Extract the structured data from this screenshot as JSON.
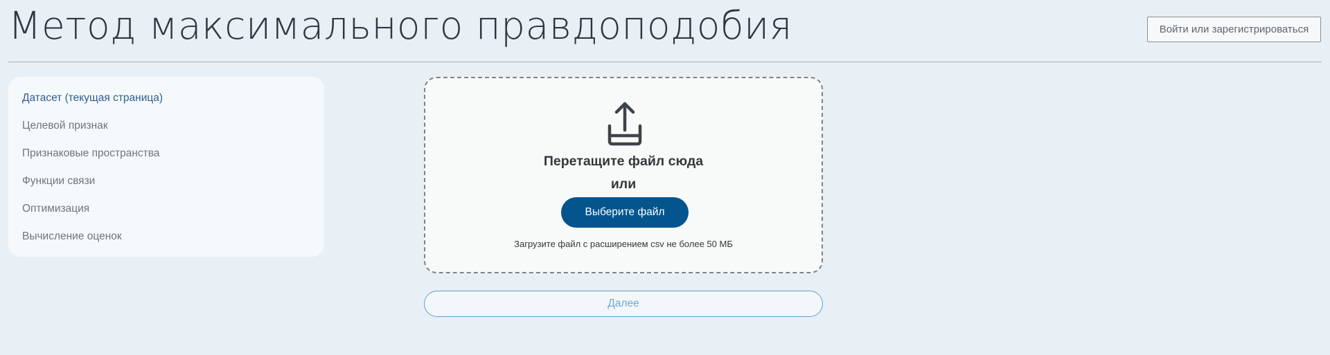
{
  "header": {
    "title": "Метод максимального правдоподобия",
    "login_label": "Войти или зарегистрироваться"
  },
  "sidebar": {
    "items": [
      {
        "label": "Датасет (текущая страница)",
        "active": true
      },
      {
        "label": "Целевой признак",
        "active": false
      },
      {
        "label": "Признаковые пространства",
        "active": false
      },
      {
        "label": "Функции связи",
        "active": false
      },
      {
        "label": "Оптимизация",
        "active": false
      },
      {
        "label": "Вычисление оценок",
        "active": false
      }
    ]
  },
  "upload": {
    "icon": "upload-icon",
    "title": "Перетащите файл сюда",
    "or": "или",
    "choose_label": "Выберите файл",
    "hint": "Загрузите файл с расширением csv не более 50 МБ"
  },
  "next_label": "Далее",
  "colors": {
    "background": "#e8f0f6",
    "panel": "#f6f9fb",
    "primary": "#04558e",
    "active_link": "#2c5d8f",
    "next_border": "#5aa2d6"
  }
}
